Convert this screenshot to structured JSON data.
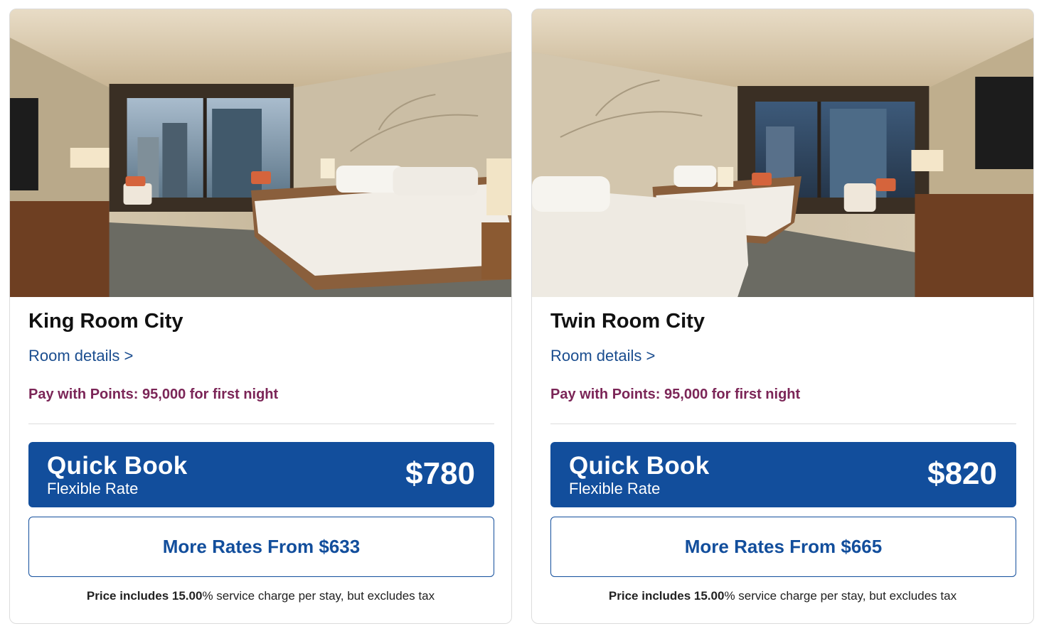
{
  "rooms": [
    {
      "name": "King Room City",
      "details_link": "Room details >",
      "points_text": "Pay with Points: 95,000 for first night",
      "quick_book": {
        "title": "Quick Book",
        "subtitle": "Flexible Rate",
        "price": "$780"
      },
      "more_rates": "More Rates From $633",
      "disclaimer": {
        "bold": "Price includes 15.00",
        "rest": "% service charge per stay, but excludes tax"
      }
    },
    {
      "name": "Twin Room City",
      "details_link": "Room details >",
      "points_text": "Pay with Points: 95,000 for first night",
      "quick_book": {
        "title": "Quick Book",
        "subtitle": "Flexible Rate",
        "price": "$820"
      },
      "more_rates": "More Rates From $665",
      "disclaimer": {
        "bold": "Price includes 15.00",
        "rest": "% service charge per stay, but excludes tax"
      }
    }
  ],
  "colors": {
    "accent_blue": "#124e9c",
    "link_blue": "#1a4d8f",
    "points_purple": "#7b2557"
  }
}
